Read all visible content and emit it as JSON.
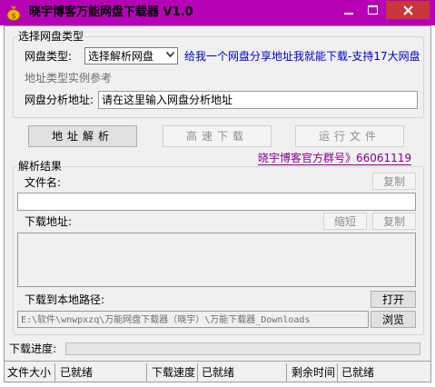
{
  "window": {
    "title": "晓宇博客万能网盘下载器 V1.0",
    "icon": "money-bag-icon",
    "controls": [
      "minimize-icon",
      "maximize-icon",
      "close-icon"
    ],
    "titlebar_color": "#b600b6"
  },
  "select_group": {
    "legend": "选择网盘类型",
    "type_label": "网盘类型:",
    "type_selected": "选择解析网盘",
    "promo_link": "给我一个网盘分享地址我就能下载-支持17大网盘",
    "example_link": "地址类型实例参考",
    "analysis_label": "网盘分析地址:",
    "analysis_value": "请在这里输入网盘分析地址"
  },
  "actions": {
    "analyze": "地址解析",
    "fast_download": "高速下载",
    "run_file": "运行文件",
    "group_link": "晓宇博客官方群号》66061119"
  },
  "result": {
    "legend": "解析结果",
    "filename_label": "文件名:",
    "copy_label": "复制",
    "download_url_label": "下载地址:",
    "shorten_label": "缩短",
    "copy2_label": "复制",
    "local_path_label": "下载到本地路径:",
    "open_label": "打开",
    "local_path_value": "E:\\软件\\wnwpxzq\\万能网盘下载器（晓宇）\\万能下载器_Downloads",
    "browse_label": "浏览"
  },
  "progress": {
    "label": "下载进度:",
    "fraction": 0,
    "fill_color": "#06b025"
  },
  "status": {
    "file_size_label": "文件大小",
    "file_size_value": "已就绪",
    "speed_label": "下载速度",
    "speed_value": "已就绪",
    "remaining_label": "剩余时间",
    "remaining_value": "已就绪"
  }
}
